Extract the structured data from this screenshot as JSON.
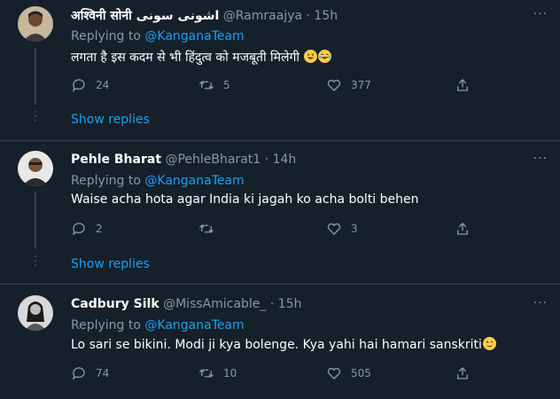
{
  "tweets": [
    {
      "name": "अश्विनी सोनी اشونی سونی",
      "handle": "@Ramraajya",
      "time": "15h",
      "replying_prefix": "Replying to",
      "replying_to": "@KanganaTeam",
      "text": "लगता है इस कदम से भी हिंदुत्व को मजबूती मिलेगी",
      "emojis": [
        "grinning-face-emoji",
        "laughing-tears-emoji"
      ],
      "replies": "24",
      "retweets": "5",
      "likes": "377",
      "show_replies": "Show replies"
    },
    {
      "name": "Pehle Bharat",
      "handle": "@PehleBharat1",
      "time": "14h",
      "replying_prefix": "Replying to",
      "replying_to": "@KanganaTeam",
      "text": "Waise acha hota agar India ki jagah ko acha bolti behen",
      "replies": "2",
      "retweets": "",
      "likes": "3",
      "show_replies": "Show replies"
    },
    {
      "name": "Cadbury Silk",
      "handle": "@MissAmicable_",
      "time": "15h",
      "replying_prefix": "Replying to",
      "replying_to": "@KanganaTeam",
      "text": "Lo sari se bikini. Modi ji kya bolenge. Kya yahi hai hamari sanskriti",
      "emojis": [
        "winking-face-emoji"
      ],
      "replies": "74",
      "retweets": "10",
      "likes": "505"
    }
  ],
  "separator": "·",
  "more_glyph": "···",
  "colors": {
    "background": "#15202b",
    "secondary_text": "#8899a6",
    "link": "#1da1f2",
    "divider": "#38444d"
  }
}
